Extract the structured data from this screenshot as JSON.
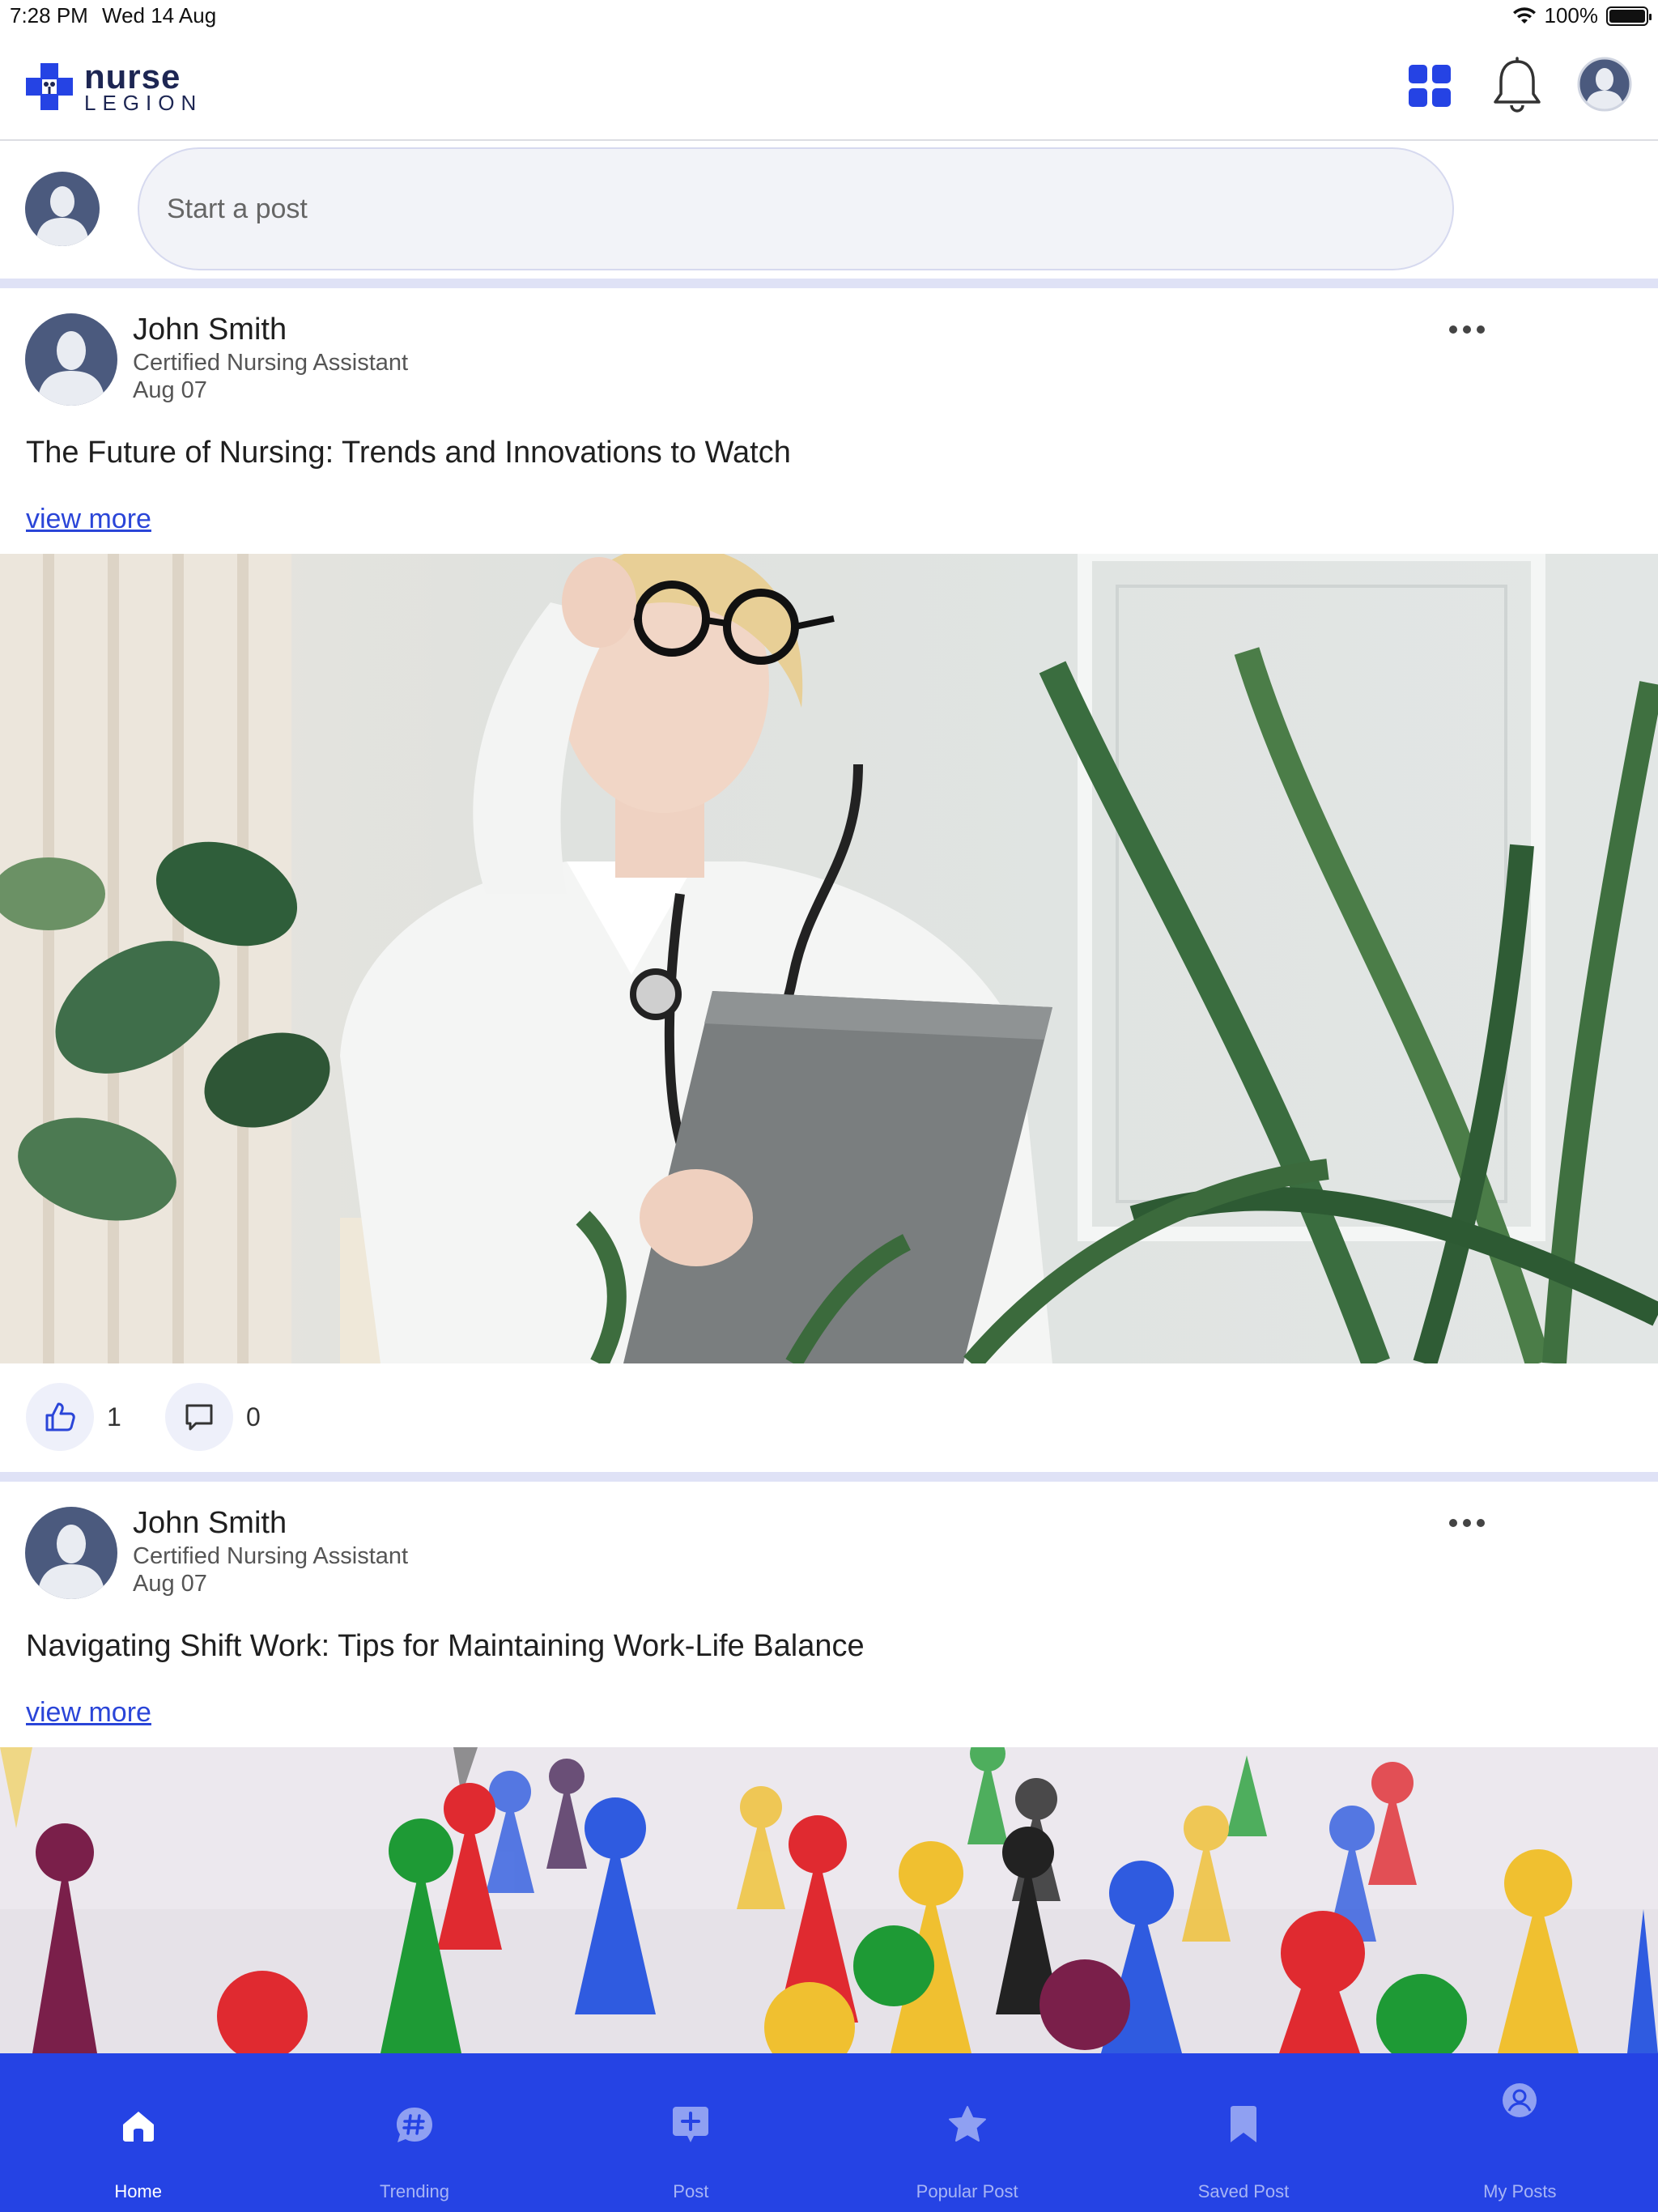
{
  "status_bar": {
    "time": "7:28 PM",
    "date": "Wed 14 Aug",
    "battery": "100%"
  },
  "header": {
    "logo_line1": "nurse",
    "logo_line2": "LEGION",
    "icons": [
      "grid-icon",
      "bell-icon",
      "profile-avatar"
    ]
  },
  "composer": {
    "placeholder": "Start a post"
  },
  "posts": [
    {
      "author": "John Smith",
      "role": "Certified Nursing Assistant",
      "date": "Aug 07",
      "title": "The Future of Nursing: Trends and Innovations to Watch",
      "view_more": "view more",
      "image": "nurse-with-glasses-and-clipboard-photo",
      "likes": "1",
      "comments": "0"
    },
    {
      "author": "John Smith",
      "role": "Certified Nursing Assistant",
      "date": "Aug 07",
      "title": "Navigating Shift Work: Tips for Maintaining Work-Life Balance",
      "view_more": "view more",
      "image": "colorful-game-pieces-photo"
    }
  ],
  "bottom_nav": {
    "items": [
      {
        "label": "Home",
        "icon": "home-icon",
        "active": true
      },
      {
        "label": "Trending",
        "icon": "hashtag-icon",
        "active": false
      },
      {
        "label": "Post",
        "icon": "plus-square-icon",
        "active": false
      },
      {
        "label": "Popular Post",
        "icon": "star-icon",
        "active": false
      },
      {
        "label": "Saved Post",
        "icon": "bookmark-icon",
        "active": false
      },
      {
        "label": "My Posts",
        "icon": "user-circle-icon",
        "active": false
      }
    ]
  },
  "colors": {
    "brand_blue": "#2543e4",
    "link_blue": "#2a45d8",
    "separator": "#dfe2f6",
    "avatar_dark": "#4b5a7e"
  }
}
